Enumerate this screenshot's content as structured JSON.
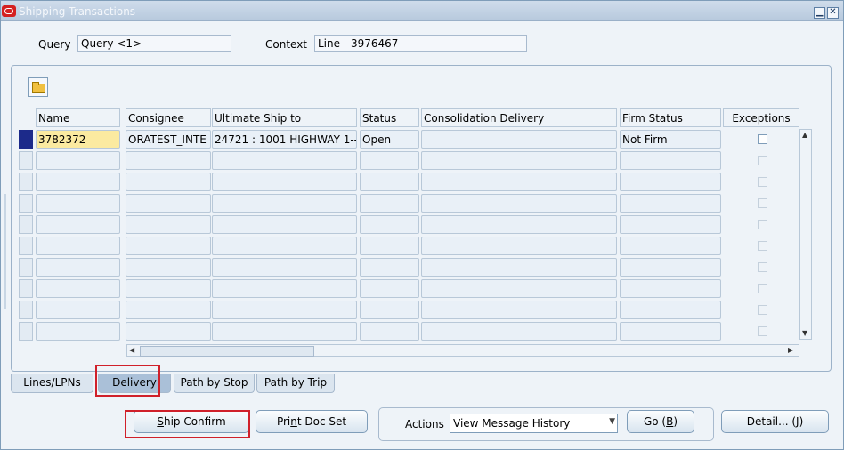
{
  "window": {
    "title": "Shipping Transactions",
    "minimize": "▁",
    "close": "✕"
  },
  "query": {
    "label": "Query",
    "value": "Query <1>"
  },
  "context": {
    "label": "Context",
    "value": "Line - 3976467"
  },
  "table": {
    "columns": [
      "Name",
      "Consignee",
      "Ultimate Ship to",
      "Status",
      "Consolidation Delivery",
      "Firm Status",
      "Exceptions"
    ],
    "rows": [
      [
        "3782372",
        "ORATEST_INTE",
        "24721 : 1001 HIGHWAY 1--",
        "Open",
        "",
        "Not Firm",
        ""
      ]
    ],
    "row_count": 10
  },
  "tabs": [
    {
      "label": "Lines/LPNs"
    },
    {
      "label": "Delivery"
    },
    {
      "label": "Path by Stop"
    },
    {
      "label": "Path by Trip"
    }
  ],
  "buttons": {
    "ship_confirm": {
      "pre": "",
      "u": "S",
      "post": "hip Confirm"
    },
    "print_doc_set": {
      "pre": "Pri",
      "u": "n",
      "post": "t Doc Set"
    },
    "go": {
      "pre": "Go (",
      "u": "B",
      "post": ")"
    },
    "detail": {
      "pre": "Detail... (",
      "u": "J",
      "post": ")"
    }
  },
  "actions": {
    "label": "Actions",
    "value": "View Message History"
  },
  "highlight_color": "#d0202a"
}
